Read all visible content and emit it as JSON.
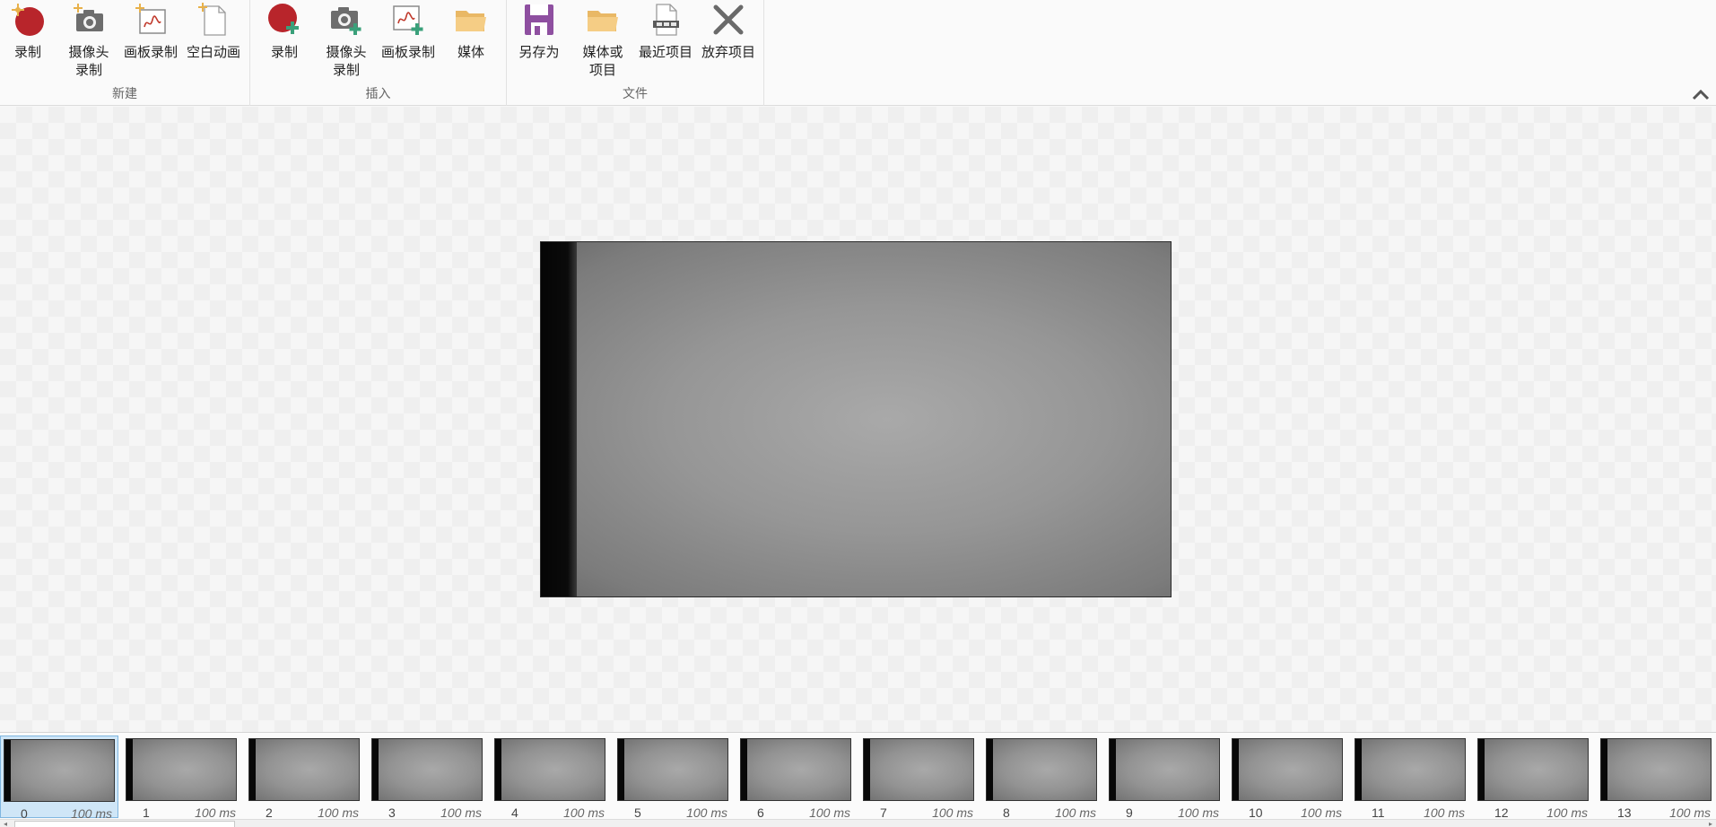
{
  "ribbon": {
    "groups": [
      {
        "label": "新建",
        "buttons": [
          {
            "label": "录制",
            "icon": "record-new-icon"
          },
          {
            "label": "摄像头\n录制",
            "icon": "webcam-new-icon"
          },
          {
            "label": "画板录制",
            "icon": "board-new-icon"
          },
          {
            "label": "空白动画",
            "icon": "blank-animation-icon"
          }
        ]
      },
      {
        "label": "插入",
        "buttons": [
          {
            "label": "录制",
            "icon": "record-insert-icon"
          },
          {
            "label": "摄像头\n录制",
            "icon": "webcam-insert-icon"
          },
          {
            "label": "画板录制",
            "icon": "board-insert-icon"
          },
          {
            "label": "媒体",
            "icon": "media-folder-icon"
          }
        ]
      },
      {
        "label": "文件",
        "buttons": [
          {
            "label": "另存为",
            "icon": "save-as-icon"
          },
          {
            "label": "媒体或\n项目",
            "icon": "open-folder-icon"
          },
          {
            "label": "最近项目",
            "icon": "recent-projects-icon"
          },
          {
            "label": "放弃项目",
            "icon": "discard-project-icon"
          }
        ]
      }
    ]
  },
  "colors": {
    "record_red": "#b8252b",
    "plus_green": "#3aa07a",
    "folder_yellow": "#f0c070",
    "save_purple": "#8e4fa0",
    "selected_frame_bg": "#cfe6f7"
  },
  "filmstrip": {
    "selected_index": 0,
    "frames": [
      {
        "num": "0",
        "duration": "100 ms"
      },
      {
        "num": "1",
        "duration": "100 ms"
      },
      {
        "num": "2",
        "duration": "100 ms"
      },
      {
        "num": "3",
        "duration": "100 ms"
      },
      {
        "num": "4",
        "duration": "100 ms"
      },
      {
        "num": "5",
        "duration": "100 ms"
      },
      {
        "num": "6",
        "duration": "100 ms"
      },
      {
        "num": "7",
        "duration": "100 ms"
      },
      {
        "num": "8",
        "duration": "100 ms"
      },
      {
        "num": "9",
        "duration": "100 ms"
      },
      {
        "num": "10",
        "duration": "100 ms"
      },
      {
        "num": "11",
        "duration": "100 ms"
      },
      {
        "num": "12",
        "duration": "100 ms"
      },
      {
        "num": "13",
        "duration": "100 ms"
      }
    ]
  }
}
